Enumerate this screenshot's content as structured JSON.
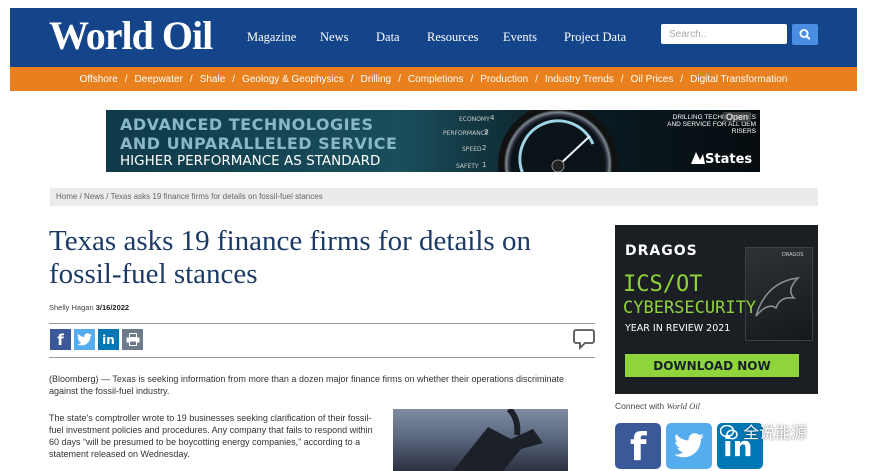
{
  "header": {
    "logo": "World Oil",
    "nav": [
      "Magazine",
      "News",
      "Data",
      "Resources",
      "Events",
      "Project Data"
    ],
    "search_placeholder": "Search.."
  },
  "categories": [
    "Offshore",
    "Deepwater",
    "Shale",
    "Geology & Geophysics",
    "Drilling",
    "Completions",
    "Production",
    "Industry Trends",
    "Oil Prices",
    "Digital Transformation"
  ],
  "category_separator": "/",
  "ad_banner": {
    "line1": "ADVANCED TECHNOLOGIES",
    "line2": "AND UNPARALLELED SERVICE",
    "line3": "HIGHER PERFORMANCE AS STANDARD",
    "gauge_labels": [
      "ECONOMY",
      "PERFORMANCE",
      "SPEED",
      "SAFETY"
    ],
    "gauge_numbers": [
      "4",
      "3",
      "2",
      "1"
    ],
    "right_text": "DRILLING TECHNOLOGIES AND SERVICE FOR ALL OEM RISERS",
    "open_label": "Open",
    "brand": "States"
  },
  "breadcrumb": [
    "Home",
    "News",
    "Texas asks 19 finance firms for details on fossil-fuel stances"
  ],
  "breadcrumb_separator": "/",
  "article": {
    "title": "Texas asks 19 finance firms for details on fossil-fuel stances",
    "author": "Shelly Hagan",
    "date": "3/16/2022",
    "p1": "(Bloomberg) — Texas is seeking information from more than a dozen major finance firms on whether their operations discriminate against the fossil-fuel industry.",
    "p2": "The state's comptroller wrote to 19 businesses seeking clarification of their fossil-fuel investment policies and procedures. Any company that fails to respond within 60 days “will be presumed to be boycotting energy companies,” according to a statement released on Wednesday."
  },
  "share": {
    "facebook": "f",
    "linkedin": "in"
  },
  "sidebar_ad": {
    "brand": "DRAGOS",
    "line1": "ICS/OT",
    "line2": "CYBERSECURITY",
    "line3": "YEAR IN REVIEW 2021",
    "button": "DOWNLOAD NOW",
    "book_brand": "DRAGOS"
  },
  "connect": {
    "prefix": "Connect with ",
    "brand": "World Oil",
    "facebook": "f",
    "linkedin": "in"
  },
  "watermark": "全说能源",
  "colors": {
    "header_blue": "#14458a",
    "orange": "#e8801d",
    "title_blue": "#1c3a66",
    "facebook": "#3b5998",
    "twitter": "#55acee",
    "linkedin": "#0077b5",
    "print": "#6d7b8a",
    "dragos_green": "#8fd43a"
  },
  "icons": [
    "search-icon",
    "facebook-icon",
    "twitter-icon",
    "linkedin-icon",
    "print-icon",
    "comment-icon"
  ]
}
